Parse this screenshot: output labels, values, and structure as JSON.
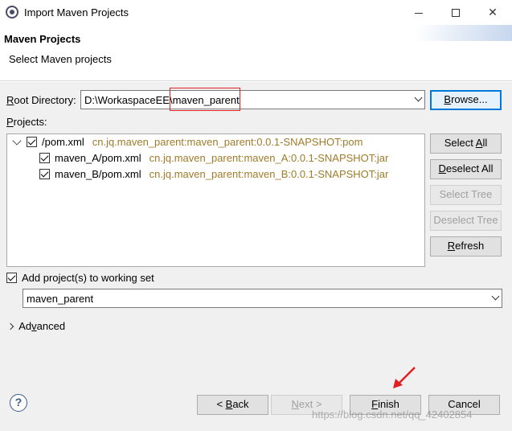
{
  "window": {
    "title": "Import Maven Projects"
  },
  "banner": {
    "title": "Maven Projects",
    "subtitle": "Select Maven projects"
  },
  "root_directory": {
    "label_prefix": "R",
    "label_rest": "oot Directory:",
    "value_prefix": "D:\\WorkaspaceEE\\",
    "value_highlight": "maven_parent",
    "browse_label_prefix": "B",
    "browse_label_rest": "rowse..."
  },
  "projects": {
    "label_prefix": "P",
    "label_rest": "rojects:",
    "items": [
      {
        "name": "/pom.xml",
        "gav": "cn.jq.maven_parent:maven_parent:0.0.1-SNAPSHOT:pom",
        "checked": true
      },
      {
        "name": "maven_A/pom.xml",
        "gav": "cn.jq.maven_parent:maven_A:0.0.1-SNAPSHOT:jar",
        "checked": true
      },
      {
        "name": "maven_B/pom.xml",
        "gav": "cn.jq.maven_parent:maven_B:0.0.1-SNAPSHOT:jar",
        "checked": true
      }
    ]
  },
  "side_buttons": {
    "select_all_prefix": "Select ",
    "select_all_u": "A",
    "select_all_rest": "ll",
    "deselect_all_prefix": "",
    "deselect_all_u": "D",
    "deselect_all_rest": "eselect All",
    "select_tree": "Select Tree",
    "deselect_tree": "Deselect Tree",
    "refresh_u": "R",
    "refresh_rest": "efresh"
  },
  "working_set": {
    "checkbox_label": "Add project(s) to working set",
    "value": "maven_parent"
  },
  "advanced": {
    "label_prefix": "Ad",
    "label_u": "v",
    "label_rest": "anced"
  },
  "footer": {
    "back_prefix": "< ",
    "back_u": "B",
    "back_rest": "ack",
    "next_u": "N",
    "next_rest": "ext >",
    "finish_u": "F",
    "finish_rest": "inish",
    "cancel": "Cancel",
    "help_icon": "?",
    "watermark": "https://blog.csdn.net/qq_42402854"
  },
  "colors": {
    "accent": "#0078d7",
    "gav_text": "#a07b2a",
    "annotation_red": "#e02020"
  }
}
